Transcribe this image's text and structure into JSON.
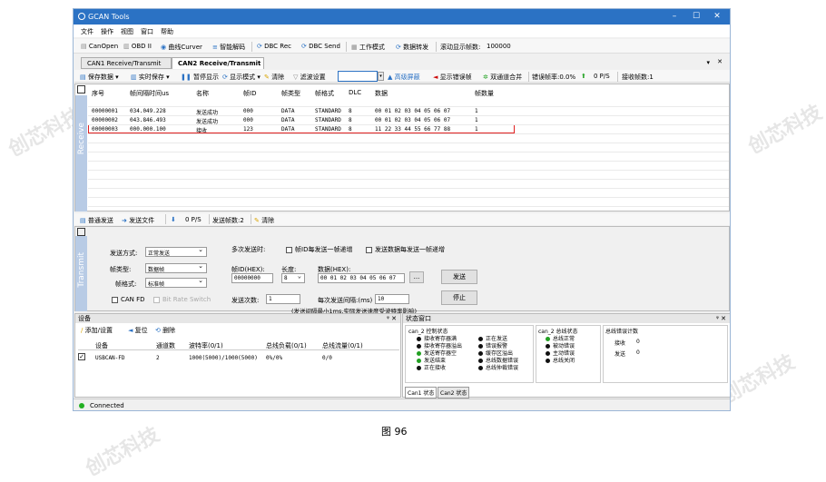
{
  "app": {
    "title": "GCAN Tools"
  },
  "menu": [
    "文件",
    "操作",
    "视图",
    "窗口",
    "帮助"
  ],
  "toolbar1": {
    "canopen": "CanOpen",
    "obd": "OBD II",
    "curve": "曲线Curver",
    "decode": "智能解码",
    "dbc_rec": "DBC Rec",
    "dbc_send": "DBC Send",
    "workmode": "工作模式",
    "forward": "数据转发",
    "rolling_label": "滚动显示帧数:",
    "rolling_value": "100000"
  },
  "tabs": [
    "CAN1 Receive/Transmit",
    "CAN2 Receive/Transmit"
  ],
  "toolbar2": {
    "save": "保存数据",
    "realtime": "实时保存",
    "pause": "暂停显示",
    "mode": "显示模式",
    "clear": "清除",
    "filter": "滤波设置",
    "advanced": "高级屏蔽",
    "show_err": "显示错误帧",
    "merge": "双通道合并",
    "err_rate": "错误帧率:0.0%",
    "ps": "0 P/S",
    "recv_count": "接收帧数:1"
  },
  "recv": {
    "side_label": "Receive",
    "headers": [
      "序号",
      "帧间隔时间us",
      "名称",
      "帧ID",
      "帧类型",
      "帧格式",
      "DLC",
      "数据",
      "帧数量"
    ],
    "rows": [
      [
        "00000001",
        "034.049.228",
        "发送成功",
        "000",
        "DATA",
        "STANDARD",
        "8",
        "00 01 02 03 04 05 06 07",
        "1"
      ],
      [
        "00000002",
        "043.846.493",
        "发送成功",
        "000",
        "DATA",
        "STANDARD",
        "8",
        "00 01 02 03 04 05 06 07",
        "1"
      ],
      [
        "00000003",
        "000.000.100",
        "接收",
        "123",
        "DATA",
        "STANDARD",
        "8",
        "11 22 33 44 55 66 77 88",
        "1"
      ]
    ]
  },
  "sendbar": {
    "normal": "普通发送",
    "file": "发送文件",
    "ps": "0 P/S",
    "sent_count": "发送帧数:2",
    "clear": "清除"
  },
  "send": {
    "side_label": "Transmit",
    "mode_label": "发送方式:",
    "mode_value": "正常发送",
    "multi_label": "多次发送时:",
    "id_inc": "帧ID每发送一帧递增",
    "data_inc": "发送数据每发送一帧递增",
    "type_label": "帧类型:",
    "type_value": "数据帧",
    "format_label": "帧格式:",
    "format_value": "标准帧",
    "id_label": "帧ID(HEX):",
    "id_value": "00000000",
    "len_label": "长度:",
    "len_value": "8",
    "data_label": "数据(HEX):",
    "data_value": "00 01 02 03 04 05 06 07",
    "more": "...",
    "send_btn": "发送",
    "stop_btn": "停止",
    "canfd": "CAN FD",
    "brs": "Bit Rate Switch",
    "times_label": "发送次数:",
    "times_value": "1",
    "interval_label": "每次发送间隔:(ms)",
    "interval_value": "10",
    "note": "(发送间隔最小1ms,实际发送速度受波特率影响)"
  },
  "device": {
    "title": "设备",
    "add": "添加/设置",
    "reset": "复位",
    "delete": "删除",
    "headers": [
      "设备",
      "通道数",
      "波特率(0/1)",
      "总线负载(0/1)",
      "总线流量(0/1)"
    ],
    "row": [
      "USBCAN-FD",
      "2",
      "1000(5000)/1000(5000)",
      "0%/0%",
      "0/0"
    ]
  },
  "status": {
    "title": "状态窗口",
    "ctrl_title": "can_2 控制状态",
    "ctrl_col1": [
      "接收寄存器满",
      "接收寄存器溢出",
      "发送寄存器空",
      "发送结束",
      "正在接收"
    ],
    "ctrl_col2": [
      "正在发送",
      "错误报警",
      "缓存区溢出",
      "总线数据错误",
      "总线仲裁错误"
    ],
    "bus_title": "can_2 总线状态",
    "bus_items": [
      "总线正常",
      "被动错误",
      "主动错误",
      "总线关闭"
    ],
    "err_title": "总线错误计数",
    "recv_label": "接收",
    "recv_val": "0",
    "send_label": "发送",
    "send_val": "0",
    "tabs": [
      "Can1 状态",
      "Can2 状态"
    ]
  },
  "statusbar": {
    "connected": "Connected"
  },
  "caption": "图 96",
  "watermark": "创芯科技"
}
